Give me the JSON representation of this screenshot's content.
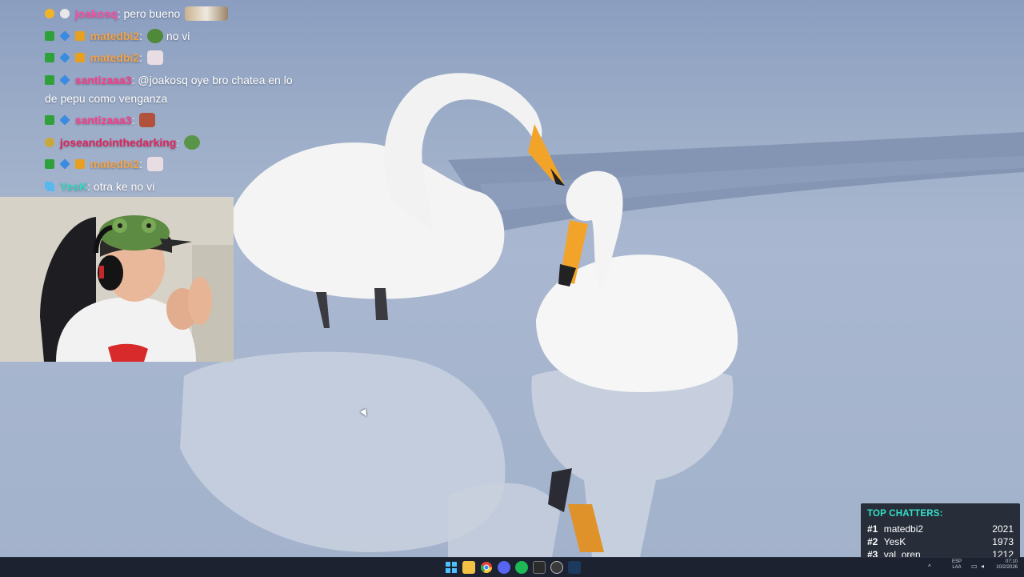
{
  "chat": {
    "messages": [
      {
        "user": "joakosq",
        "text": "pero bueno",
        "user_color": "#ff4fa6"
      },
      {
        "user": "matedbi2",
        "text": "no vi",
        "user_color": "#f0a24a"
      },
      {
        "user": "matedbi2",
        "text": "",
        "user_color": "#f0a24a"
      },
      {
        "user": "santizaaa3",
        "text": "@joakosq oye bro chatea en lo de pepu como venganza",
        "user_color": "#ff3a8a"
      },
      {
        "user": "santizaaa3",
        "text": "",
        "user_color": "#ff3a8a"
      },
      {
        "user": "joseandointhedarking",
        "text": "",
        "user_color": "#e0245e"
      },
      {
        "user": "matedbi2",
        "text": "",
        "user_color": "#f0a24a"
      },
      {
        "user": "YesK",
        "text": "otra ke no vi",
        "user_color": "#3ad6c4"
      }
    ]
  },
  "top_chatters": {
    "title": "TOP CHATTERS:",
    "entries": [
      {
        "rank": "#1",
        "name": "matedbi2",
        "count": "2021"
      },
      {
        "rank": "#2",
        "name": "YesK",
        "count": "1973"
      },
      {
        "rank": "#3",
        "name": "val_oren",
        "count": "1212"
      }
    ]
  },
  "taskbar": {
    "icons": [
      "windows-start-icon",
      "file-explorer-icon",
      "chrome-icon",
      "discord-icon",
      "spotify-icon",
      "app-icon",
      "obs-icon",
      "steam-icon"
    ],
    "tray": {
      "lang_top": "ESP",
      "lang_bottom": "LAA",
      "time": "07:10",
      "date": "10/2/2026"
    }
  },
  "colors": {
    "accent": "#35e0c8",
    "taskbar": "#1d2230"
  }
}
